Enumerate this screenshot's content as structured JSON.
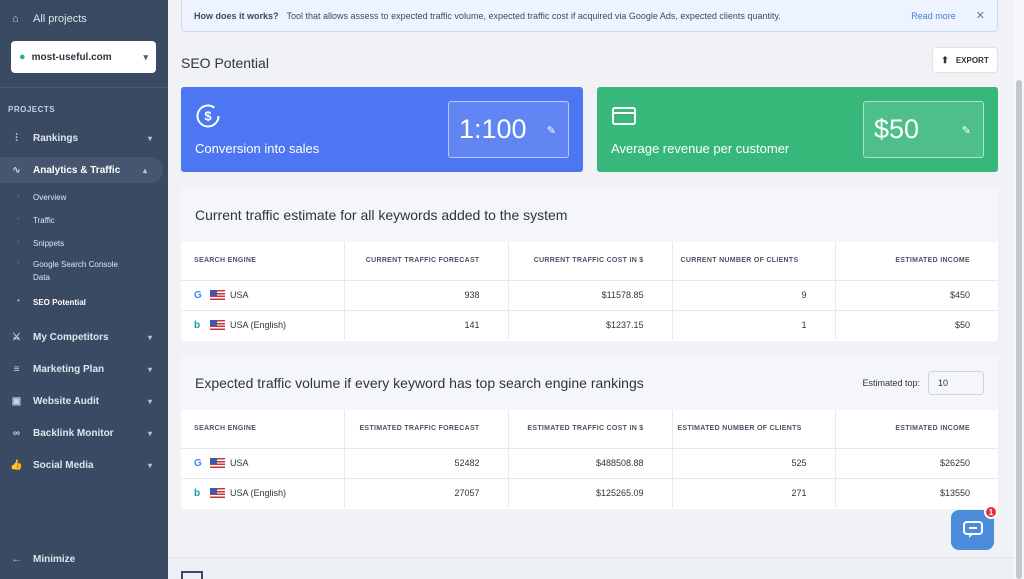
{
  "sidebar": {
    "all_projects": "All projects",
    "project": "most-useful.com",
    "section": "PROJECTS",
    "nav": [
      {
        "label": "Rankings"
      },
      {
        "label": "Analytics & Traffic"
      },
      {
        "label": "My Competitors"
      },
      {
        "label": "Marketing Plan"
      },
      {
        "label": "Website Audit"
      },
      {
        "label": "Backlink Monitor"
      },
      {
        "label": "Social Media"
      }
    ],
    "sub": [
      "Overview",
      "Traffic",
      "Snippets",
      "Google Search Console Data",
      "SEO Potential"
    ],
    "minimize": "Minimize"
  },
  "info": {
    "question": "How does it works?",
    "text": "Tool that allows assess to expected traffic volume, expected traffic cost if acquired via Google Ads, expected clients quantity.",
    "read_more": "Read more"
  },
  "page": {
    "title": "SEO Potential",
    "export": "EXPORT"
  },
  "cards": {
    "conversion_label": "Conversion into sales",
    "conversion_value": "1:100",
    "revenue_label": "Average revenue per customer",
    "revenue_value": "$50"
  },
  "table1": {
    "title": "Current traffic estimate for all keywords added to the system",
    "headers": [
      "SEARCH ENGINE",
      "CURRENT TRAFFIC FORECAST",
      "CURRENT TRAFFIC COST IN $",
      "CURRENT NUMBER OF CLIENTS",
      "ESTIMATED INCOME"
    ],
    "rows": [
      {
        "engine": "USA",
        "forecast": "938",
        "cost": "$11578.85",
        "clients": "9",
        "income": "$450"
      },
      {
        "engine": "USA (English)",
        "forecast": "141",
        "cost": "$1237.15",
        "clients": "1",
        "income": "$50"
      }
    ]
  },
  "table2": {
    "title": "Expected traffic volume if every keyword has top search engine rankings",
    "est_top_label": "Estimated top:",
    "est_top_value": "10",
    "headers": [
      "SEARCH ENGINE",
      "ESTIMATED TRAFFIC FORECAST",
      "ESTIMATED TRAFFIC COST IN $",
      "ESTIMATED NUMBER OF CLIENTS",
      "ESTIMATED INCOME"
    ],
    "rows": [
      {
        "engine": "USA",
        "forecast": "52482",
        "cost": "$488508.88",
        "clients": "525",
        "income": "$26250"
      },
      {
        "engine": "USA (English)",
        "forecast": "27057",
        "cost": "$125265.09",
        "clients": "271",
        "income": "$13550"
      }
    ]
  },
  "chat": {
    "badge": "1"
  }
}
